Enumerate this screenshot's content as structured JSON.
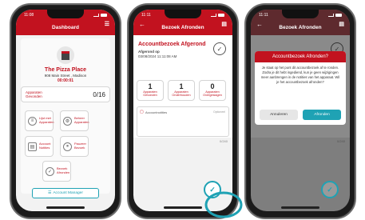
{
  "colors": {
    "dashboard_bar": "#c2121f",
    "detail_bar": "#9b2b33",
    "brand_red": "#c2121f",
    "teal": "#1fa2b4",
    "modal_bar": "#c2121f"
  },
  "phone1": {
    "time": "11:08",
    "title": "Dashboard",
    "store_name": "The Pizza Place",
    "address": "908 Main Street , Madison",
    "timer": "00:00:01",
    "devices_label": "Apparaten Gevonden",
    "devices_count": "0/16",
    "tiles": [
      {
        "icon": "list-icon",
        "label": "Lijst met Apparaten"
      },
      {
        "icon": "gear-icon",
        "label": "Beheer Apparaten"
      },
      {
        "icon": "clipboard-icon",
        "label": "Account Notities"
      },
      {
        "icon": "pause-icon",
        "label": "Pauzeer Bezoek"
      },
      {
        "icon": "check-icon",
        "label": "Bezoek Afronden"
      }
    ],
    "account_manager": "Account Manager"
  },
  "phone2": {
    "time": "11:11",
    "title": "Bezoek Afronden",
    "heading": "Accountbezoek Afgerond",
    "sub_label": "Afgerond op",
    "date": "03/08/2024 11:11:08 AM",
    "stats": [
      {
        "n": "1",
        "label": "Apparaten Gevonden"
      },
      {
        "n": "1",
        "label": "Apparaten Onderhouden"
      },
      {
        "n": "0",
        "label": "Apparaten Overgeslagen"
      }
    ],
    "notes_label": "Accountnotities",
    "notes_hint": "Optioneel",
    "counter": "0/240"
  },
  "phone3": {
    "time": "11:11",
    "title": "Bezoek Afronden",
    "modal_title": "Accountbezoek Afronden?",
    "modal_text": "Je staat op het punt dit accountbezoek af te ronden. Zodra je dit hebt ingediend, kun je geen wijzigingen meer aanbrengen in de notities van het apparaat. Wil je het accountbezoek afronden?",
    "cancel": "Annuleren",
    "confirm": "Afronden",
    "counter": "0/240"
  }
}
